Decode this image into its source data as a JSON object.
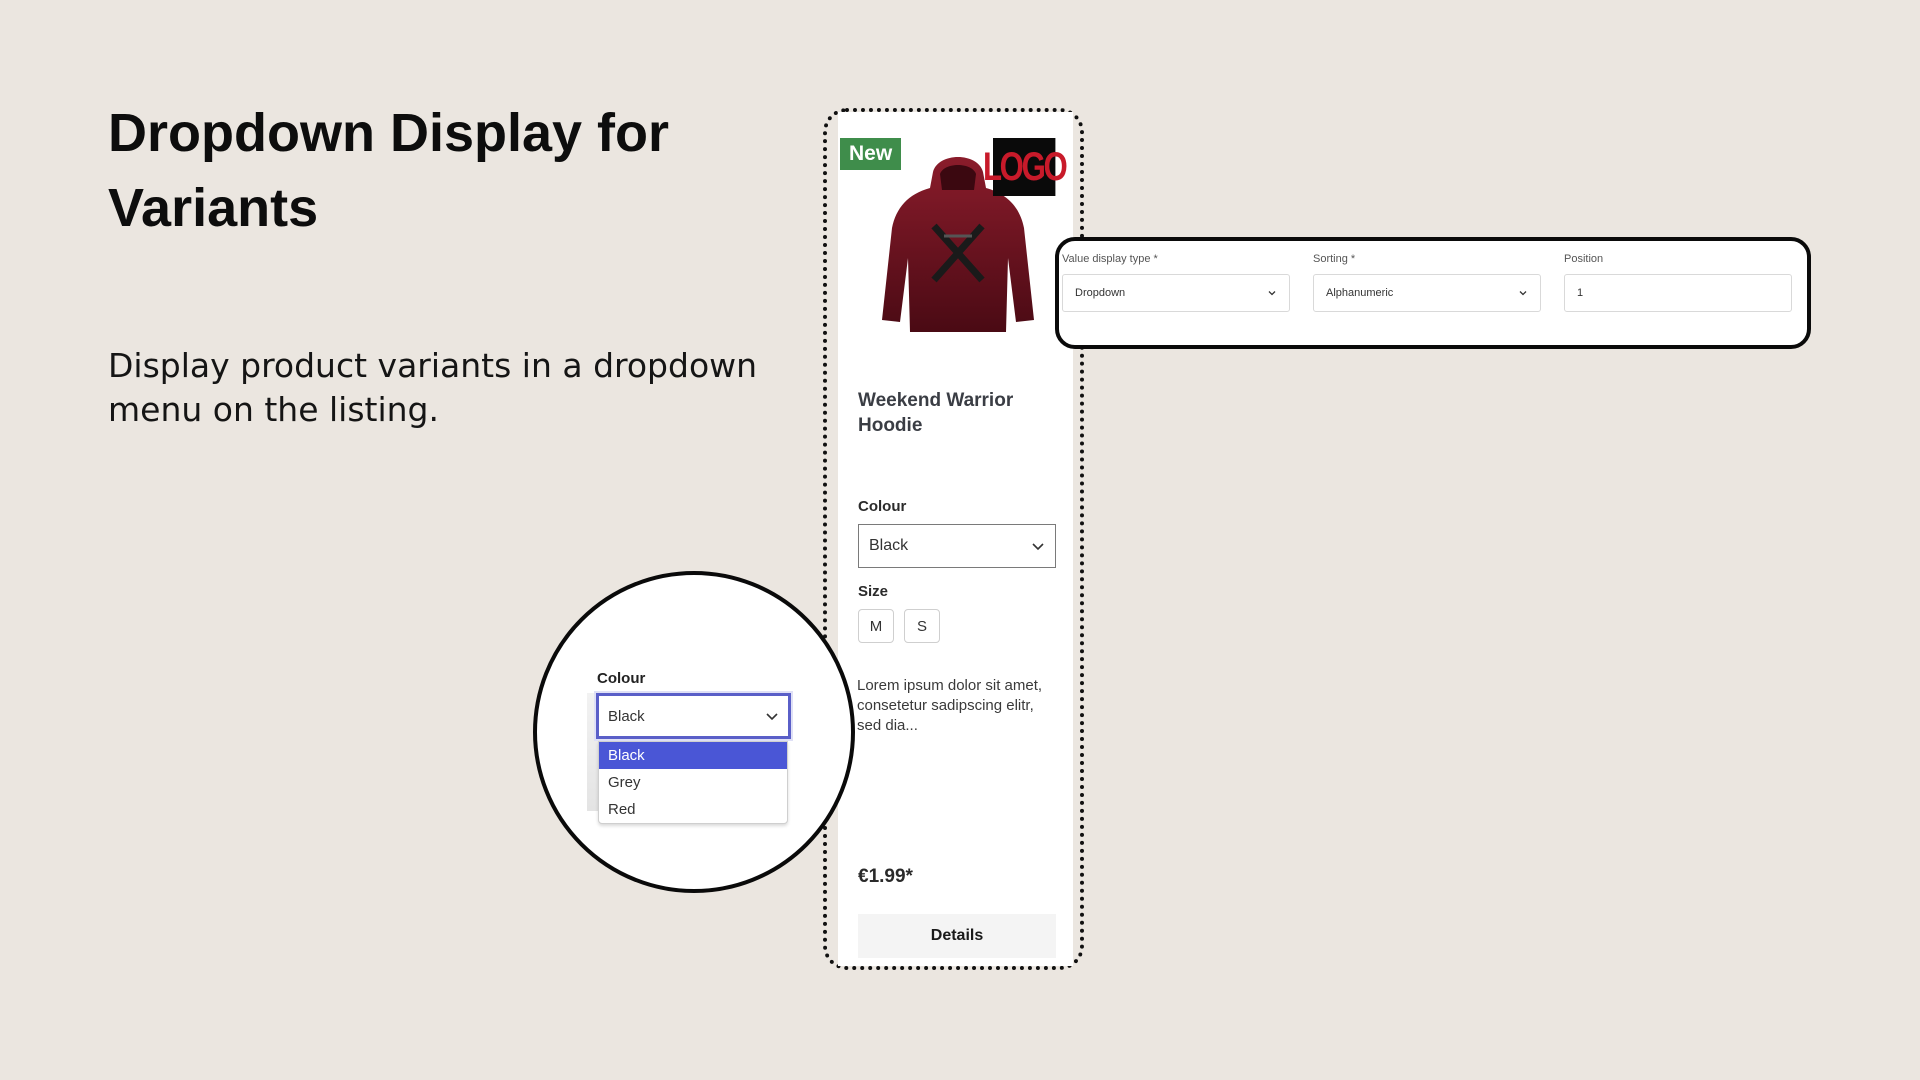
{
  "headline": "Dropdown Display for Variants",
  "description": "Display product variants in a dropdown menu on the listing.",
  "product_card": {
    "badge": "New",
    "logo_text": "LOGO",
    "title": "Weekend Warrior Hoodie",
    "colour_label": "Colour",
    "colour_value": "Black",
    "size_label": "Size",
    "sizes": [
      "M",
      "S"
    ],
    "description": "Lorem ipsum dolor sit amet, consetetur sadipscing elitr, sed dia...",
    "price": "€1.99*",
    "details_button": "Details"
  },
  "settings": {
    "display_type": {
      "label": "Value display type *",
      "value": "Dropdown"
    },
    "sorting": {
      "label": "Sorting *",
      "value": "Alphanumeric"
    },
    "position": {
      "label": "Position",
      "value": "1"
    }
  },
  "zoom": {
    "label": "Colour",
    "selected": "Black",
    "options": [
      "Black",
      "Grey",
      "Red"
    ],
    "highlighted_option": "Black"
  },
  "colors": {
    "background": "#ebe6e0",
    "badge_green": "#3f8d4b",
    "highlight_blue": "#4a56d6",
    "hoodie_maroon": "#7a1422"
  }
}
